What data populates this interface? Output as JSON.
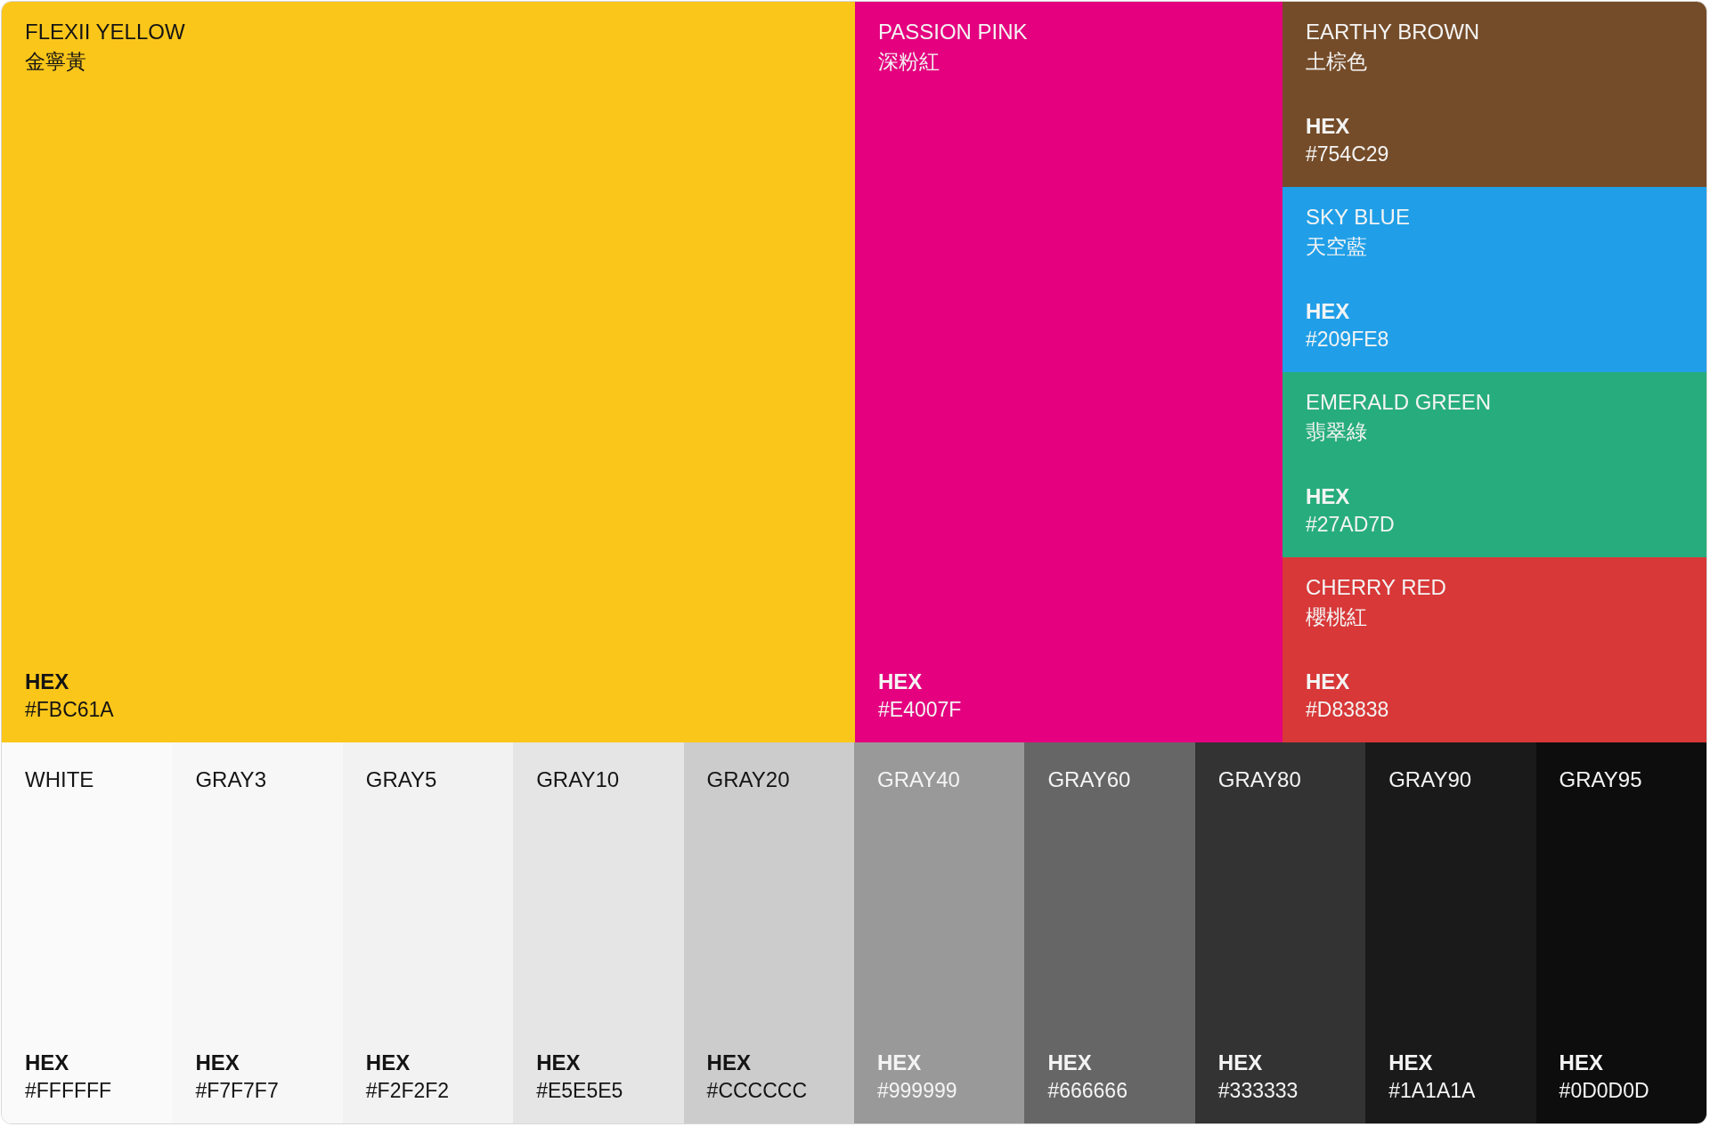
{
  "primary": [
    {
      "name": "FLEXII YELLOW",
      "name_zh": "金寧黃",
      "hex_label": "HEX",
      "hex": "#FBC61A",
      "color": "#fbc61a"
    },
    {
      "name": "PASSION PINK",
      "name_zh": "深粉紅",
      "hex_label": "HEX",
      "hex": "#E4007F",
      "color": "#e4007f"
    }
  ],
  "secondary": [
    {
      "name": "EARTHY BROWN",
      "name_zh": "土棕色",
      "hex_label": "HEX",
      "hex": "#754C29",
      "color": "#754c29"
    },
    {
      "name": "SKY BLUE",
      "name_zh": "天空藍",
      "hex_label": "HEX",
      "hex": "#209FE8",
      "color": "#209fe8"
    },
    {
      "name": "EMERALD GREEN",
      "name_zh": "翡翠綠",
      "hex_label": "HEX",
      "hex": "#27AD7D",
      "color": "#27ad7d"
    },
    {
      "name": "CHERRY RED",
      "name_zh": "櫻桃紅",
      "hex_label": "HEX",
      "hex": "#D83838",
      "color": "#d83838"
    }
  ],
  "grays": [
    {
      "name": "WHITE",
      "hex_label": "HEX",
      "hex": "#FFFFFF",
      "color": "#fafafa"
    },
    {
      "name": "GRAY3",
      "hex_label": "HEX",
      "hex": "#F7F7F7",
      "color": "#f7f7f7"
    },
    {
      "name": "GRAY5",
      "hex_label": "HEX",
      "hex": "#F2F2F2",
      "color": "#f2f2f2"
    },
    {
      "name": "GRAY10",
      "hex_label": "HEX",
      "hex": "#E5E5E5",
      "color": "#e5e5e5"
    },
    {
      "name": "GRAY20",
      "hex_label": "HEX",
      "hex": "#CCCCCC",
      "color": "#cccccc"
    },
    {
      "name": "GRAY40",
      "hex_label": "HEX",
      "hex": "#999999",
      "color": "#999999"
    },
    {
      "name": "GRAY60",
      "hex_label": "HEX",
      "hex": "#666666",
      "color": "#666666"
    },
    {
      "name": "GRAY80",
      "hex_label": "HEX",
      "hex": "#333333",
      "color": "#333333"
    },
    {
      "name": "GRAY90",
      "hex_label": "HEX",
      "hex": "#1A1A1A",
      "color": "#1a1a1a"
    },
    {
      "name": "GRAY95",
      "hex_label": "HEX",
      "hex": "#0D0D0D",
      "color": "#0d0d0d"
    }
  ]
}
